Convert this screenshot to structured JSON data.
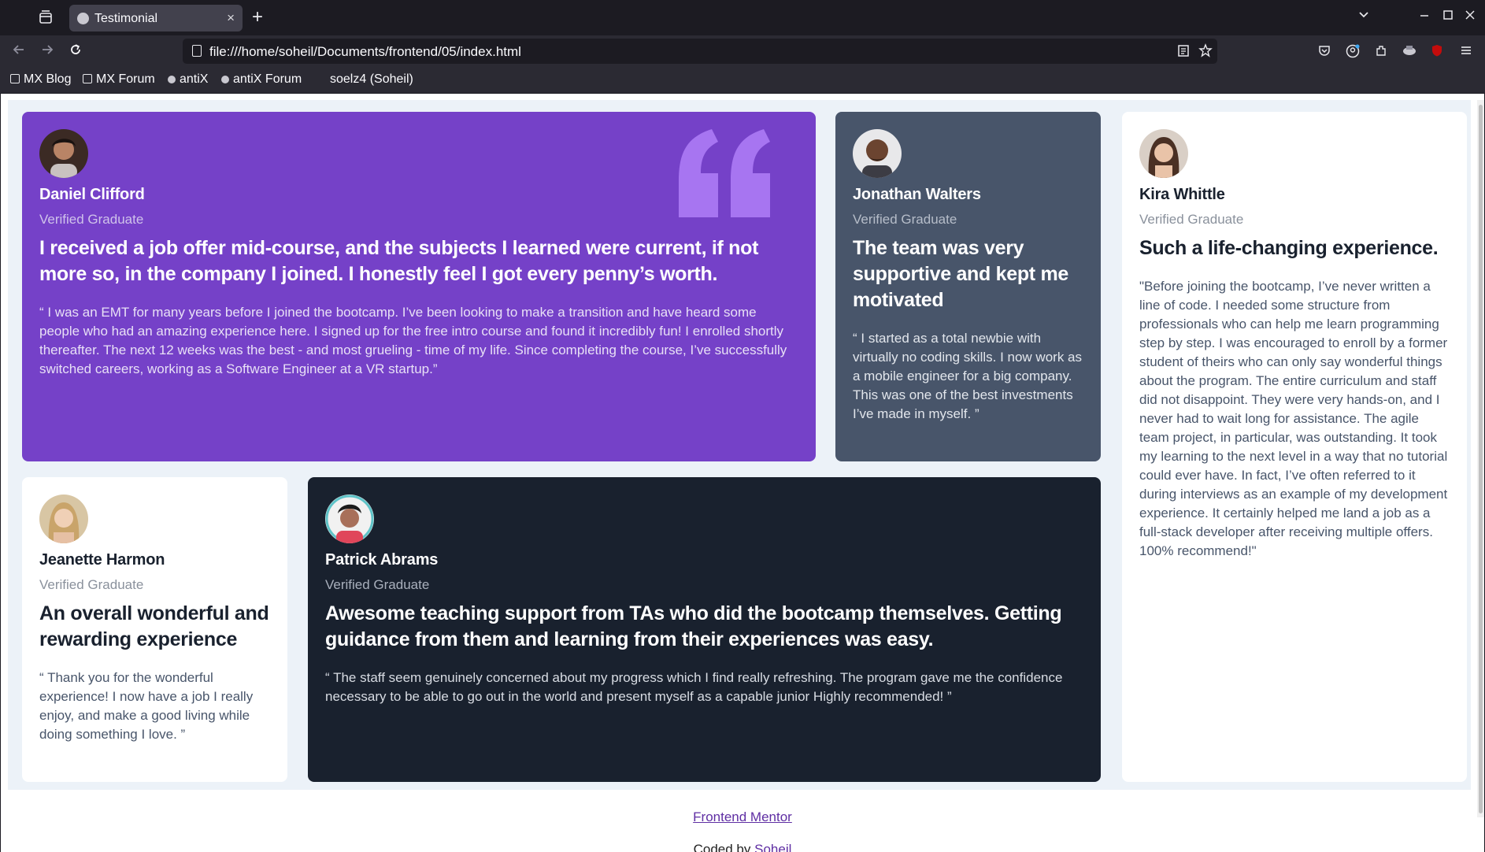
{
  "browser": {
    "tab_title": "Testimonial",
    "tab_close": "×",
    "new_tab": "+",
    "url": "file:///home/soheil/Documents/frontend/05/index.html",
    "bookmarks": [
      {
        "label": "MX Blog",
        "icon": "image-icon"
      },
      {
        "label": "MX Forum",
        "icon": "image-icon"
      },
      {
        "label": "antiX",
        "icon": "globe-icon"
      },
      {
        "label": "antiX Forum",
        "icon": "globe-icon"
      },
      {
        "label": "soelz4 (Soheil)",
        "icon": "none"
      }
    ]
  },
  "testimonials": [
    {
      "name": "Daniel Clifford",
      "role": "Verified Graduate",
      "headline": "I received a job offer mid-course, and the subjects I learned were current, if not more so, in the company I joined. I honestly feel I got every penny’s worth.",
      "quote": "“ I was an EMT for many years before I joined the bootcamp. I’ve been looking to make a transition and have heard some people who had an amazing experience here. I signed up for the free intro course and found it incredibly fun! I enrolled shortly thereafter. The next 12 weeks was the best - and most grueling - time of my life. Since completing the course, I’ve successfully switched careers, working as a Software Engineer at a VR startup.”",
      "color": "#7541c8"
    },
    {
      "name": "Jonathan Walters",
      "role": "Verified Graduate",
      "headline": "The team was very supportive and kept me motivated",
      "quote": "“ I started as a total newbie with virtually no coding skills. I now work as a mobile engineer for a big company. This was one of the best investments I’ve made in myself. ”",
      "color": "#48556a"
    },
    {
      "name": "Kira Whittle",
      "role": "Verified Graduate",
      "headline": "Such a life-changing experience.",
      "quote": "\"Before joining the bootcamp, I’ve never written a line of code. I needed some structure from professionals who can help me learn programming step by step. I was encouraged to enroll by a former student of theirs who can only say wonderful things about the program. The entire curriculum and staff did not disappoint. They were very hands-on, and I never had to wait long for assistance. The agile team project, in particular, was outstanding. It took my learning to the next level in a way that no tutorial could ever have. In fact, I’ve often referred to it during interviews as an example of my development experience. It certainly helped me land a job as a full-stack developer after receiving multiple offers. 100% recommend!\"",
      "color": "#ffffff"
    },
    {
      "name": "Jeanette Harmon",
      "role": "Verified Graduate",
      "headline": "An overall wonderful and rewarding experience",
      "quote": "“ Thank you for the wonderful experience! I now have a job I really enjoy, and make a good living while doing something I love. ”",
      "color": "#ffffff"
    },
    {
      "name": "Patrick Abrams",
      "role": "Verified Graduate",
      "headline": "Awesome teaching support from TAs who did the bootcamp themselves. Getting guidance from them and learning from their experiences was easy.",
      "quote": "“ The staff seem genuinely concerned about my progress which I find really refreshing. The program gave me the confidence necessary to be able to go out in the world and present myself as a capable junior Highly recommended! ”",
      "color": "#19212e"
    }
  ],
  "attribution": {
    "link_label": "Frontend Mentor",
    "coded_by": "Coded by",
    "author": "Soheil"
  }
}
